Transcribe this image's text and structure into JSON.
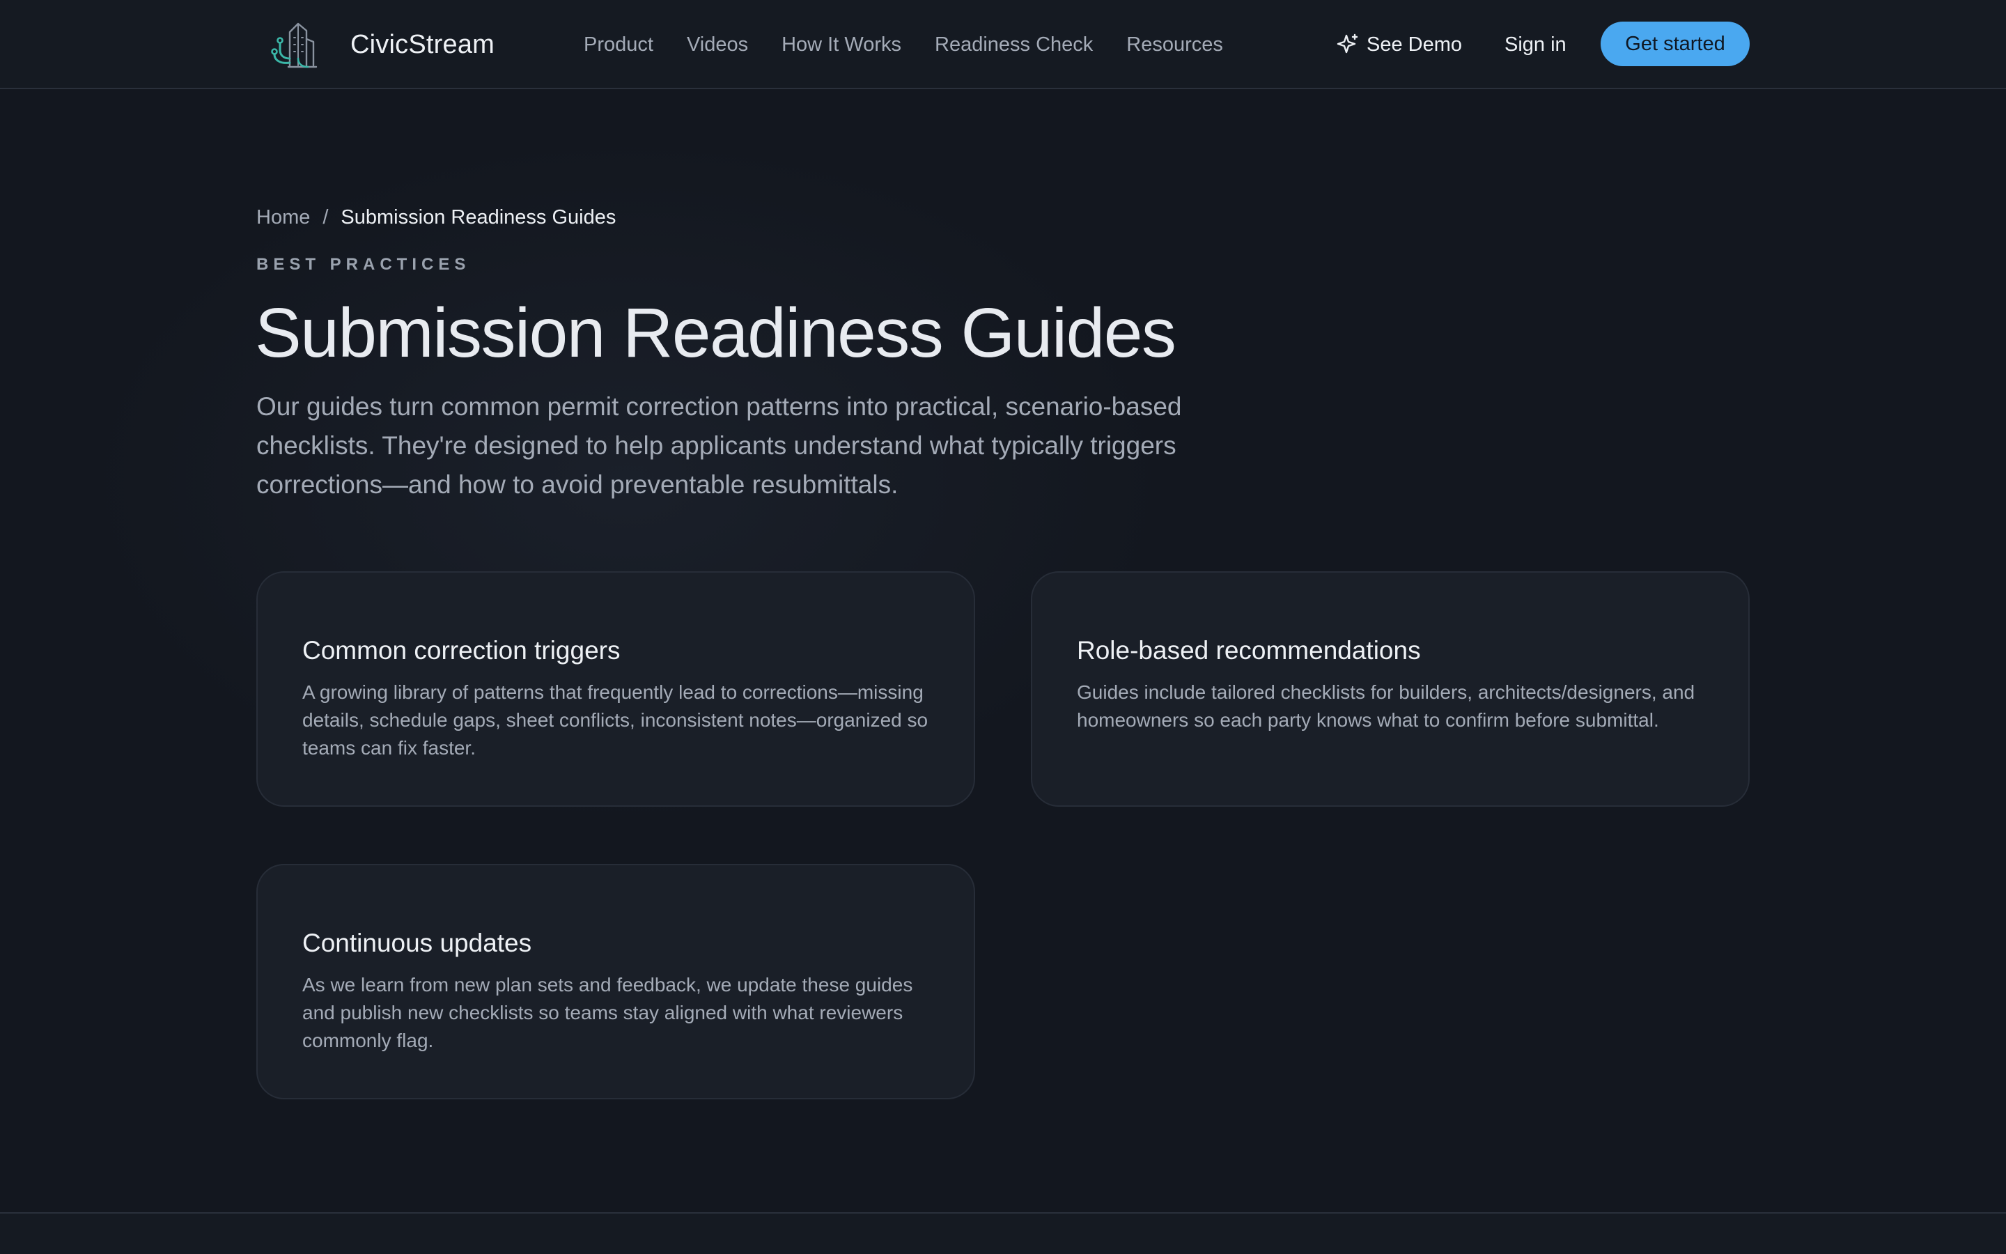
{
  "header": {
    "brand": "CivicStream",
    "nav": [
      "Product",
      "Videos",
      "How It Works",
      "Readiness Check",
      "Resources"
    ],
    "demo_label": "See Demo",
    "signin_label": "Sign in",
    "cta_label": "Get started"
  },
  "breadcrumb": {
    "home": "Home",
    "separator": "/",
    "current": "Submission Readiness Guides"
  },
  "hero": {
    "eyebrow": "BEST PRACTICES",
    "title": "Submission Readiness Guides",
    "lead": "Our guides turn common permit correction patterns into practical, scenario-based checklists. They're designed to help applicants understand what typically triggers corrections—and how to avoid preventable resubmittals."
  },
  "cards": [
    {
      "title": "Common correction triggers",
      "body": "A growing library of patterns that frequently lead to corrections—missing details, schedule gaps, sheet conflicts, inconsistent notes—organized so teams can fix faster."
    },
    {
      "title": "Role-based recommendations",
      "body": "Guides include tailored checklists for builders, architects/designers, and homeowners so each party knows what to confirm before submittal."
    },
    {
      "title": "Continuous updates",
      "body": "As we learn from new plan sets and feedback, we update these guides and publish new checklists so teams stay aligned with what reviewers commonly flag."
    }
  ],
  "colors": {
    "background": "#13171f",
    "accent": "#4aa8f0",
    "logo": "#3bb7a8"
  },
  "icons": {
    "logo": "building-circuit-logo-icon",
    "demo": "sparkle-icon"
  }
}
